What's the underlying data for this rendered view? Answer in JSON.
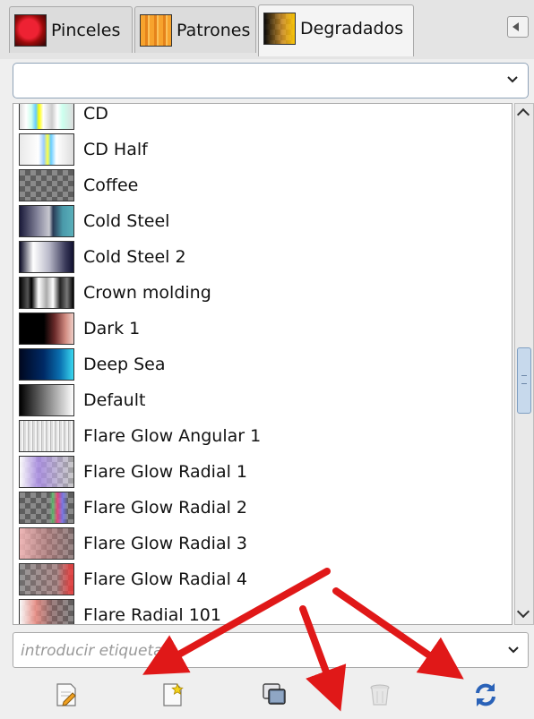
{
  "tabs": [
    {
      "label": "Pinceles",
      "icon": "brush-icon",
      "active": false
    },
    {
      "label": "Patrones",
      "icon": "pattern-icon",
      "active": false
    },
    {
      "label": "Degradados",
      "icon": "gradient-icon",
      "active": true
    }
  ],
  "filter_combo": {
    "value": ""
  },
  "gradients": [
    {
      "name": "CD"
    },
    {
      "name": "CD Half"
    },
    {
      "name": "Coffee"
    },
    {
      "name": "Cold Steel"
    },
    {
      "name": "Cold Steel 2"
    },
    {
      "name": "Crown molding"
    },
    {
      "name": "Dark 1"
    },
    {
      "name": "Deep Sea"
    },
    {
      "name": "Default"
    },
    {
      "name": "Flare Glow Angular 1"
    },
    {
      "name": "Flare Glow Radial 1"
    },
    {
      "name": "Flare Glow Radial 2"
    },
    {
      "name": "Flare Glow Radial 3"
    },
    {
      "name": "Flare Glow Radial 4"
    },
    {
      "name": "Flare Radial 101"
    }
  ],
  "tag_entry": {
    "placeholder": "introducir etiquetas"
  },
  "toolbar": [
    {
      "icon": "edit-gradient-icon"
    },
    {
      "icon": "new-gradient-icon"
    },
    {
      "icon": "duplicate-gradient-icon"
    },
    {
      "icon": "delete-gradient-icon",
      "disabled": true
    },
    {
      "icon": "refresh-gradients-icon"
    }
  ],
  "colors": {
    "annotation_arrow": "#e01818",
    "scroll_thumb": "#c7d9ec",
    "combo_border": "#8fa3b8"
  }
}
